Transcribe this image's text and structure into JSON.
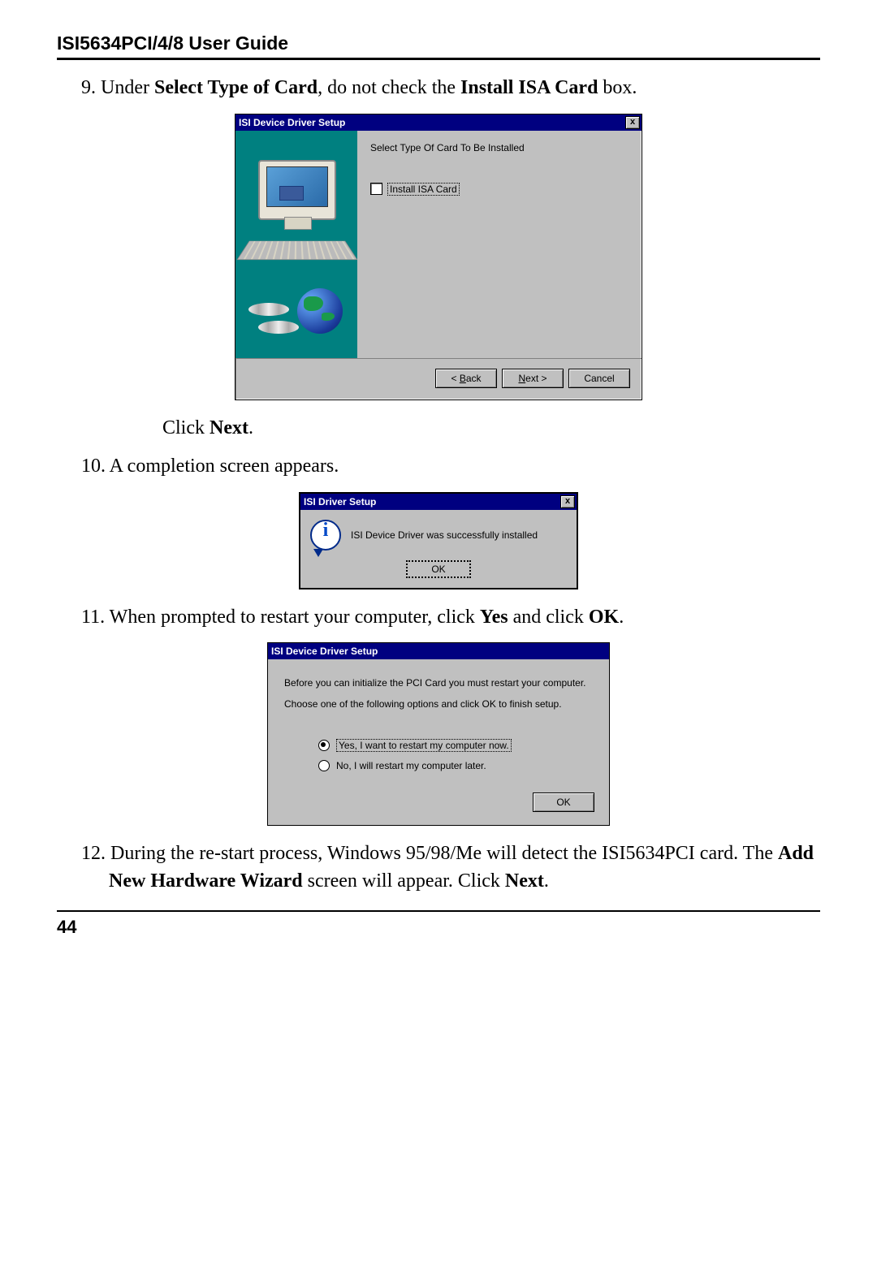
{
  "header": {
    "title": "ISI5634PCI/4/8 User Guide"
  },
  "steps": {
    "s9_num": "9.",
    "s9_a": " Under ",
    "s9_b": "Select Type of Card",
    "s9_c": ", do not check the ",
    "s9_d": "Install ISA Card",
    "s9_e": " box.",
    "s9_click_a": "Click ",
    "s9_click_b": "Next",
    "s9_click_c": ".",
    "s10_num": "10.",
    "s10_a": "  A completion screen appears.",
    "s11_num": "11.",
    "s11_a": "  When prompted to restart your computer, click ",
    "s11_b": "Yes",
    "s11_c": " and click ",
    "s11_d": "OK",
    "s11_e": ".",
    "s12_num": "12.",
    "s12_a": "  During the re-start process,  Windows 95/98/Me  will detect the ISI5634PCI card.  The ",
    "s12_b": "Add New Hardware Wizard",
    "s12_c": " screen will appear.  Click ",
    "s12_d": "Next",
    "s12_e": "."
  },
  "dlg1": {
    "title": "ISI Device Driver Setup",
    "close": "x",
    "heading": "Select Type Of Card To Be Installed",
    "checkbox_label": "Install ISA Card",
    "back_pre": "< ",
    "back_u": "B",
    "back_post": "ack",
    "next_u": "N",
    "next_post": "ext >",
    "cancel": "Cancel"
  },
  "dlg2": {
    "title": "ISI Driver Setup",
    "close": "x",
    "message": "ISI Device Driver was successfully  installed",
    "ok": "OK"
  },
  "dlg3": {
    "title": "ISI Device Driver Setup",
    "line1": "Before you can initialize the PCI Card you must restart your computer.",
    "line2": "Choose one of the following options and click OK to finish setup.",
    "opt_yes": "Yes, I want to restart my computer now.",
    "opt_no": "No, I will restart my computer later.",
    "ok": "OK"
  },
  "footer": {
    "page": "44"
  }
}
